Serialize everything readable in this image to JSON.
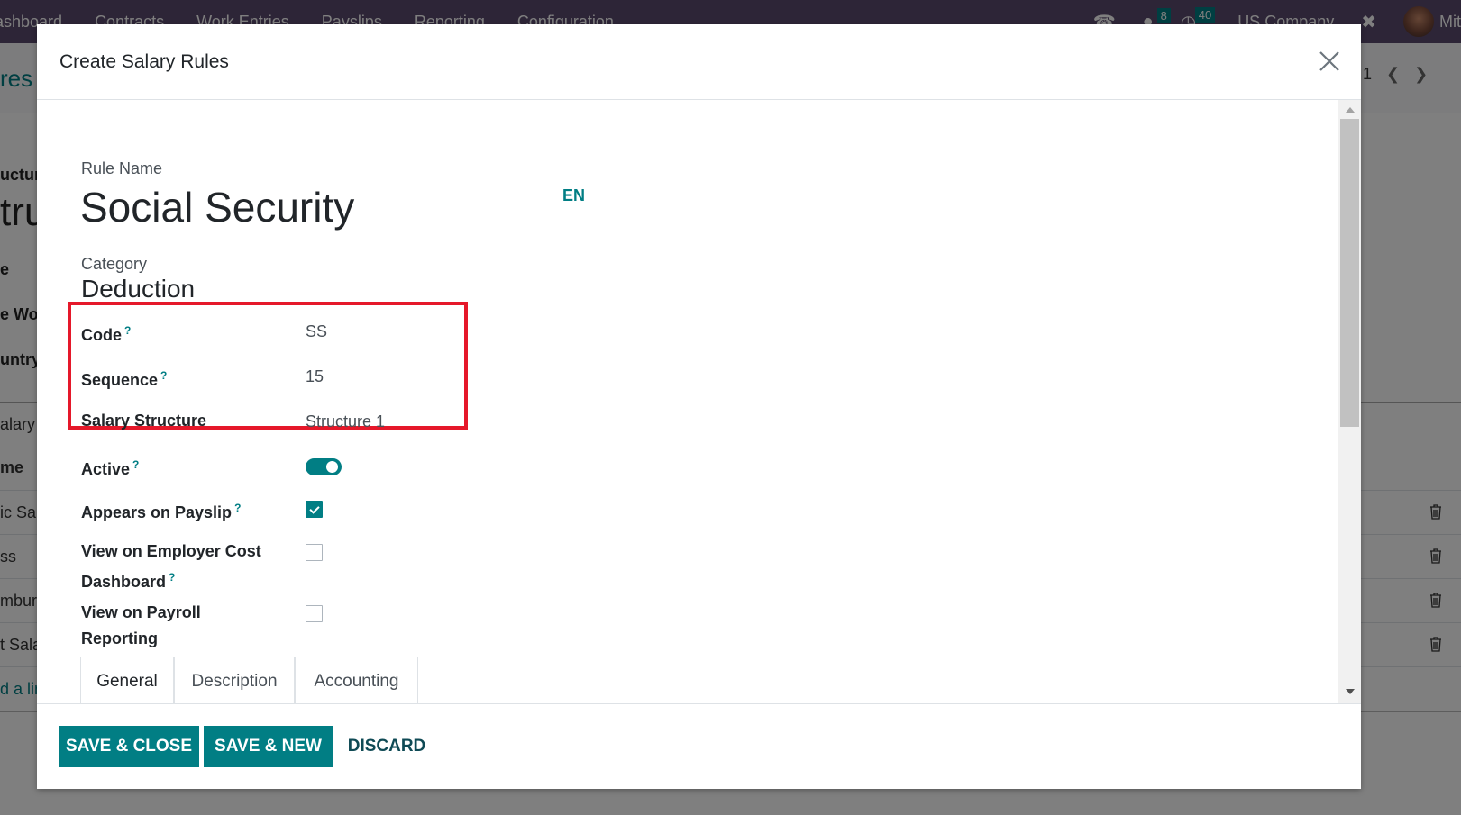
{
  "navbar": {
    "menu_items": [
      "ashboard",
      "Contracts",
      "Work Entries",
      "Payslips",
      "Reporting",
      "Configuration"
    ],
    "messages_count": "8",
    "activities_count": "40",
    "company": "US Company",
    "user_name": "Mit"
  },
  "background": {
    "breadcrumb": "res",
    "pager_value": "1",
    "labels": [
      "uctur",
      "e",
      "e Wor",
      "untry"
    ],
    "big_title": "tru",
    "section_label": "alary",
    "table_header": "me",
    "rows": [
      "ic Sa",
      "ss",
      "mbur",
      "t Sala"
    ],
    "add_line": "d a lin"
  },
  "modal": {
    "title": "Create Salary Rules",
    "rule_name_label": "Rule Name",
    "rule_name": "Social Security",
    "language": "EN",
    "category_label": "Category",
    "category": "Deduction",
    "fields": {
      "code": {
        "label": "Code",
        "help": "?",
        "value": "SS"
      },
      "sequence": {
        "label": "Sequence",
        "help": "?",
        "value": "15"
      },
      "salary_structure": {
        "label": "Salary Structure",
        "value": "Structure 1"
      },
      "active": {
        "label": "Active",
        "help": "?",
        "value": true
      },
      "appears_on_payslip": {
        "label": "Appears on Payslip",
        "help": "?",
        "value": true
      },
      "employer_cost": {
        "label_line1": "View on Employer Cost",
        "label_line2": "Dashboard",
        "help": "?",
        "value": false
      },
      "payroll_reporting": {
        "label_line1": "View on Payroll",
        "label_line2": "Reporting",
        "value": false
      }
    },
    "tabs": [
      {
        "label": "General",
        "active": true
      },
      {
        "label": "Description",
        "active": false
      },
      {
        "label": "Accounting",
        "active": false
      }
    ],
    "footer": {
      "save_close": "SAVE & CLOSE",
      "save_new": "SAVE & NEW",
      "discard": "DISCARD"
    }
  },
  "colors": {
    "primary": "#017e84",
    "highlight_box": "#e5182a",
    "navbar": "#5b4a6e"
  }
}
